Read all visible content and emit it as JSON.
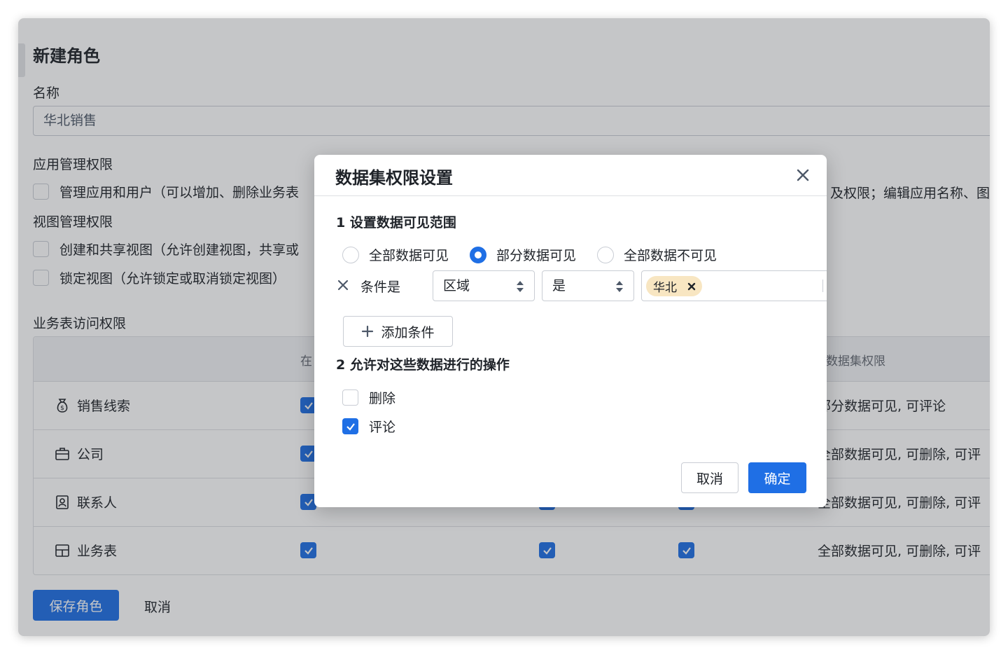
{
  "page": {
    "title": "新建角色",
    "name_label": "名称",
    "name_value": "华北销售",
    "app_perm_label": "应用管理权限",
    "app_perm_item": "管理应用和用户（可以增加、删除业务表",
    "app_perm_item_tail": "及权限；编辑应用名称、图",
    "view_perm_label": "视图管理权限",
    "view_perm_items": [
      "创建和共享视图（允许创建视图，共享或",
      "锁定视图（允许锁定或取消锁定视图）"
    ],
    "table_perm_label": "业务表访问权限",
    "table_headers": [
      "在",
      "数据集权限"
    ],
    "rows": [
      {
        "name": "销售线索",
        "icon": "money-bag-icon",
        "summary": "部分数据可见, 可评论"
      },
      {
        "name": "公司",
        "icon": "briefcase-icon",
        "summary": "全部数据可见, 可删除, 可评"
      },
      {
        "name": "联系人",
        "icon": "contact-card-icon",
        "summary": "全部数据可见, 可删除, 可评"
      },
      {
        "name": "业务表",
        "icon": "table-icon",
        "summary": "全部数据可见, 可删除, 可评"
      }
    ],
    "save_label": "保存角色",
    "cancel_label": "取消"
  },
  "modal": {
    "title": "数据集权限设置",
    "section1": "1 设置数据可见范围",
    "radio_options": [
      "全部数据可见",
      "部分数据可见",
      "全部数据不可见"
    ],
    "radio_selected": "部分数据可见",
    "condition_label": "条件是",
    "field_select": "区域",
    "operator_select": "是",
    "tags": [
      "华北"
    ],
    "add_condition_label": "添加条件",
    "section2": "2 允许对这些数据进行的操作",
    "operations": [
      {
        "label": "删除",
        "checked": false
      },
      {
        "label": "评论",
        "checked": true
      }
    ],
    "cancel_label": "取消",
    "ok_label": "确定"
  },
  "colors": {
    "primary": "#1f6fe5",
    "tag_bg": "#f8e6c2",
    "border": "#c9cdd4",
    "overlay": "rgba(45,50,58,0.28)"
  }
}
